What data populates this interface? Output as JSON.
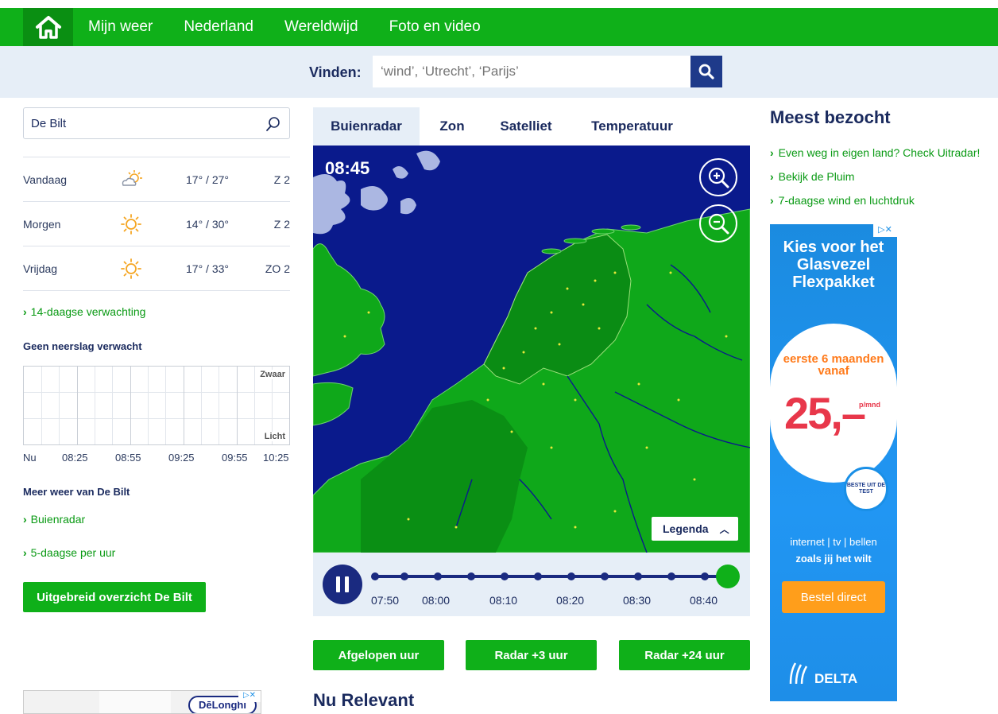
{
  "nav": {
    "items": [
      "Mijn weer",
      "Nederland",
      "Wereldwijd",
      "Foto en video"
    ]
  },
  "search": {
    "label": "Vinden:",
    "placeholder": "‘wind’, ‘Utrecht’, ‘Parijs’"
  },
  "location": {
    "value": "De Bilt"
  },
  "forecast": [
    {
      "day": "Vandaag",
      "icon": "partly-cloudy-sun-icon",
      "temp": "17° / 27°",
      "wind": "Z 2"
    },
    {
      "day": "Morgen",
      "icon": "sun-icon",
      "temp": "14° / 30°",
      "wind": "Z 2"
    },
    {
      "day": "Vrijdag",
      "icon": "sun-icon",
      "temp": "17° / 33°",
      "wind": "ZO 2"
    }
  ],
  "links": {
    "fourteen_day": "14-daagse verwachting",
    "buienradar": "Buienradar",
    "five_day": "5-daagse per uur"
  },
  "rain": {
    "title": "Geen neerslag verwacht",
    "heavy": "Zwaar",
    "light": "Licht",
    "times": [
      "Nu",
      "08:25",
      "08:55",
      "09:25",
      "09:55",
      "10:25"
    ]
  },
  "more": {
    "title": "Meer weer van De Bilt",
    "overview_button": "Uitgebreid overzicht De Bilt"
  },
  "tabs": [
    "Buienradar",
    "Zon",
    "Satelliet",
    "Temperatuur"
  ],
  "radar": {
    "time": "08:45",
    "legend": "Legenda",
    "timeline": [
      "07:50",
      "08:00",
      "08:10",
      "08:20",
      "08:30",
      "08:40"
    ],
    "buttons": [
      "Afgelopen uur",
      "Radar +3 uur",
      "Radar +24 uur"
    ]
  },
  "nu_relevant": "Nu Relevant",
  "meest_bezocht": {
    "title": "Meest bezocht",
    "links": [
      "Even weg in eigen land? Check Uitradar!",
      "Bekijk de Pluim",
      "7-daagse wind en luchtdruk"
    ]
  },
  "ad": {
    "headline": "Kies voor het Glasvezel Flexpakket",
    "offer": "eerste 6 maanden vanaf",
    "price": "25,–",
    "per_month": "p/mnd",
    "badge": "BESTE UIT DE TEST",
    "services": "internet | tv | bellen",
    "tagline": "zoals jij het wilt",
    "cta": "Bestel direct",
    "brand": "DELTA"
  },
  "bottom_ad": {
    "brand": "DēLonghi"
  },
  "colors": {
    "nav_green": "#0fb019",
    "navy": "#1a2a5e",
    "light_blue": "#e6eef7",
    "map_sea": "#0a1a8c",
    "land": "#0fa81a"
  }
}
